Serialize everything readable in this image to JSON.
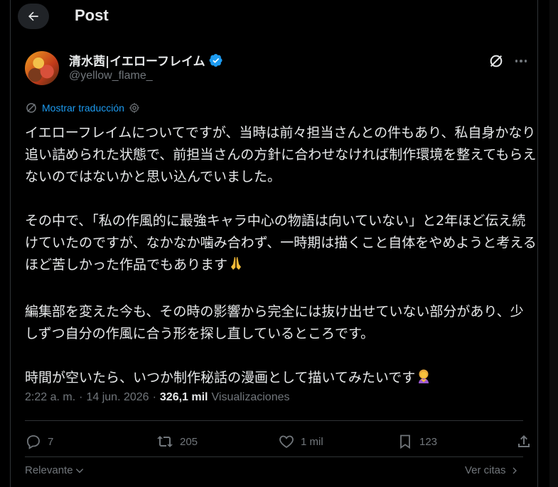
{
  "header": {
    "title": "Post",
    "back_icon": "arrow-left-icon"
  },
  "author": {
    "display_name": "清水茜|イエローフレイム",
    "handle": "@yellow_flame_",
    "verified": true,
    "verified_color": "#1d9bf0"
  },
  "translate": {
    "label": "Mostrar traducción"
  },
  "post": {
    "paragraphs": [
      "イエローフレイムについてですが、当時は前々担当さんとの件もあり、私自身かなり追い詰められた状態で、前担当さんの方針に合わせなければ制作環境を整えてもらえないのではないかと思い込んでいました。",
      "その中で、「私の作風的に最強キャラ中心の物語は向いていない」と2年ほど伝え続けていたのですが、なかなか噛み合わず、一時期は描くこと自体をやめようと考えるほど苦しかった作品でもあります",
      "編集部を変えた今も、その時の影響から完全には抜け出せていない部分があり、少しずつ自分の作風に合う形を探し直しているところです。",
      "時間が空いたら、いつか制作秘話の漫画として描いてみたいです"
    ],
    "emoji_1": "folded-hands-emoji",
    "emoji_2": "person-bowing-emoji"
  },
  "meta": {
    "time": "2:22 a. m.",
    "separator": "·",
    "date": "14 jun. 2026",
    "views_count": "326,1 mil",
    "views_label": "Visualizaciones"
  },
  "actions": {
    "replies": "7",
    "reposts": "205",
    "likes": "1 mil",
    "bookmarks": "123"
  },
  "footer": {
    "sort_label": "Relevante",
    "quotes_label": "Ver citas"
  },
  "colors": {
    "background": "#000000",
    "text": "#e7e9ea",
    "muted": "#71767b",
    "accent": "#1d9bf0",
    "divider": "#2f3336"
  }
}
